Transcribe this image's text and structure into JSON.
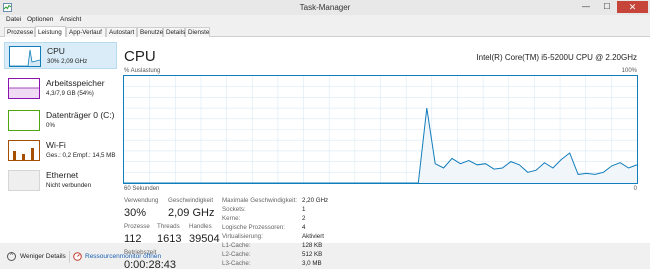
{
  "window": {
    "title": "Task-Manager",
    "minimize": "—",
    "maximize": "☐",
    "close": "✕"
  },
  "menu": [
    "Datei",
    "Optionen",
    "Ansicht"
  ],
  "tabs": [
    "Prozesse",
    "Leistung",
    "App-Verlauf",
    "Autostart",
    "Benutzer",
    "Details",
    "Dienste"
  ],
  "active_tab": "Leistung",
  "sidebar": [
    {
      "name": "CPU",
      "sub": "30% 2,09 GHz",
      "color": "#117dbb",
      "selected": true
    },
    {
      "name": "Arbeitsspeicher",
      "sub": "4,3/7,9 GB (54%)",
      "color": "#8b12ae"
    },
    {
      "name": "Datenträger 0 (C:)",
      "sub": "0%",
      "color": "#4da60c"
    },
    {
      "name": "Wi-Fi",
      "sub": "Ges.: 0,2  Empf.: 14,5 MB",
      "color": "#a74f01"
    },
    {
      "name": "Ethernet",
      "sub": "Nicht verbunden",
      "color": "#a0a0a0"
    }
  ],
  "main": {
    "title": "CPU",
    "cpu_model": "Intel(R) Core(TM) i5-5200U CPU @ 2.20GHz",
    "util_label": "% Auslastung",
    "util_max": "100%",
    "time_label": "60 Sekunden",
    "time_min": "0"
  },
  "chart_data": {
    "type": "area",
    "ylim": [
      0,
      100
    ],
    "x_unit": "seconds (60 → 0)",
    "values": [
      0,
      0,
      0,
      0,
      0,
      0,
      0,
      0,
      0,
      0,
      0,
      0,
      0,
      0,
      0,
      0,
      0,
      0,
      0,
      0,
      0,
      0,
      0,
      0,
      0,
      0,
      0,
      0,
      0,
      0,
      0,
      0,
      0,
      0,
      0,
      0,
      70,
      18,
      14,
      23,
      18,
      21,
      17,
      18,
      13,
      14,
      20,
      17,
      10,
      12,
      19,
      14,
      22,
      28,
      8,
      9,
      8,
      10,
      16,
      19,
      14,
      17
    ],
    "colors": {
      "line": "#117dbb",
      "fill": "#f1f6fa",
      "grid": "#d9eaf4"
    }
  },
  "stats": {
    "verwendung": {
      "label": "Verwendung",
      "value": "30%"
    },
    "geschwindigkeit": {
      "label": "Geschwindigkeit",
      "value": "2,09 GHz"
    },
    "prozesse": {
      "label": "Prozesse",
      "value": "112"
    },
    "threads": {
      "label": "Threads",
      "value": "1613"
    },
    "handles": {
      "label": "Handles",
      "value": "39504"
    },
    "betriebszeit": {
      "label": "Betriebszeit",
      "value": "0:00:28:43"
    }
  },
  "specs": [
    {
      "label": "Maximale Geschwindigkeit:",
      "value": "2,20 GHz"
    },
    {
      "label": "Sockets:",
      "value": "1"
    },
    {
      "label": "Kerne:",
      "value": "2"
    },
    {
      "label": "Logische Prozessoren:",
      "value": "4"
    },
    {
      "label": "Virtualisierung:",
      "value": "Aktiviert"
    },
    {
      "label": "L1-Cache:",
      "value": "128 KB"
    },
    {
      "label": "L2-Cache:",
      "value": "512 KB"
    },
    {
      "label": "L3-Cache:",
      "value": "3,0 MB"
    }
  ],
  "footer": {
    "fewer_details": "Weniger Details",
    "resource_monitor": "Ressourcenmonitor öffnen"
  }
}
